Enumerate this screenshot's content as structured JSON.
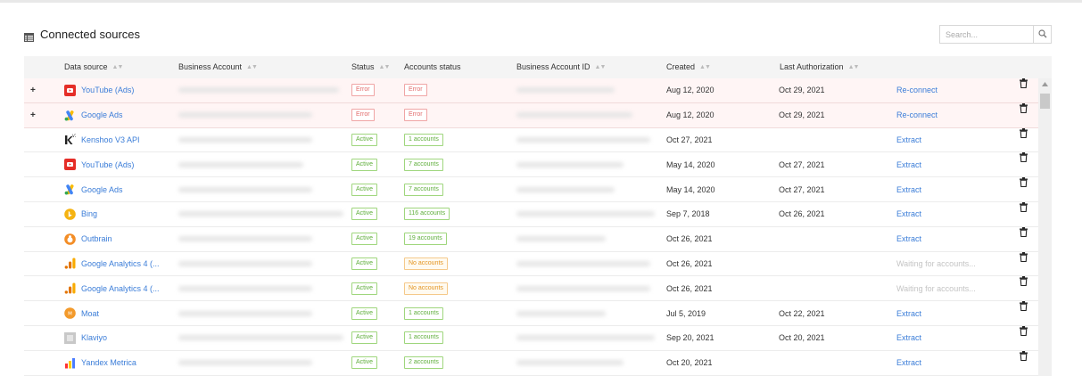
{
  "header": {
    "title": "Connected sources",
    "title_icon": "table-list-icon",
    "search_placeholder": "Search...",
    "search_icon": "search-icon"
  },
  "columns": {
    "data_source": "Data source",
    "business_account": "Business Account",
    "status": "Status",
    "accounts_status": "Accounts status",
    "business_account_id": "Business Account ID",
    "created": "Created",
    "last_authorization": "Last Authorization"
  },
  "rows": [
    {
      "expandable": true,
      "icon": "youtube-icon",
      "source": "YouTube (Ads)",
      "status": "Error",
      "status_type": "error",
      "accounts": "Error",
      "accounts_type": "error",
      "created": "Aug 12, 2020",
      "last_auth": "Oct 29, 2021",
      "action": "Re-connect",
      "action_type": "link"
    },
    {
      "expandable": true,
      "icon": "google-ads-icon",
      "source": "Google Ads",
      "status": "Error",
      "status_type": "error",
      "accounts": "Error",
      "accounts_type": "error",
      "created": "Aug 12, 2020",
      "last_auth": "Oct 29, 2021",
      "action": "Re-connect",
      "action_type": "link"
    },
    {
      "expandable": false,
      "icon": "kenshoo-icon",
      "source": "Kenshoo V3 API",
      "status": "Active",
      "status_type": "active",
      "accounts": "1 accounts",
      "accounts_type": "active",
      "created": "Oct 27, 2021",
      "last_auth": "",
      "action": "Extract",
      "action_type": "link"
    },
    {
      "expandable": false,
      "icon": "youtube-icon",
      "source": "YouTube (Ads)",
      "status": "Active",
      "status_type": "active",
      "accounts": "7 accounts",
      "accounts_type": "active",
      "created": "May 14, 2020",
      "last_auth": "Oct 27, 2021",
      "action": "Extract",
      "action_type": "link"
    },
    {
      "expandable": false,
      "icon": "google-ads-icon",
      "source": "Google Ads",
      "status": "Active",
      "status_type": "active",
      "accounts": "7 accounts",
      "accounts_type": "active",
      "created": "May 14, 2020",
      "last_auth": "Oct 27, 2021",
      "action": "Extract",
      "action_type": "link"
    },
    {
      "expandable": false,
      "icon": "bing-icon",
      "source": "Bing",
      "status": "Active",
      "status_type": "active",
      "accounts": "116 accounts",
      "accounts_type": "active",
      "created": "Sep 7, 2018",
      "last_auth": "Oct 26, 2021",
      "action": "Extract",
      "action_type": "link"
    },
    {
      "expandable": false,
      "icon": "outbrain-icon",
      "source": "Outbrain",
      "status": "Active",
      "status_type": "active",
      "accounts": "19 accounts",
      "accounts_type": "active",
      "created": "Oct 26, 2021",
      "last_auth": "",
      "action": "Extract",
      "action_type": "link"
    },
    {
      "expandable": false,
      "icon": "google-analytics-icon",
      "source": "Google Analytics 4 (...",
      "status": "Active",
      "status_type": "active",
      "accounts": "No accounts",
      "accounts_type": "none",
      "created": "Oct 26, 2021",
      "last_auth": "",
      "action": "Waiting for accounts...",
      "action_type": "wait"
    },
    {
      "expandable": false,
      "icon": "google-analytics-icon",
      "source": "Google Analytics 4 (...",
      "status": "Active",
      "status_type": "active",
      "accounts": "No accounts",
      "accounts_type": "none",
      "created": "Oct 26, 2021",
      "last_auth": "",
      "action": "Waiting for accounts...",
      "action_type": "wait"
    },
    {
      "expandable": false,
      "icon": "moat-icon",
      "source": "Moat",
      "status": "Active",
      "status_type": "active",
      "accounts": "1 accounts",
      "accounts_type": "active",
      "created": "Jul 5, 2019",
      "last_auth": "Oct 22, 2021",
      "action": "Extract",
      "action_type": "link"
    },
    {
      "expandable": false,
      "icon": "klaviyo-icon",
      "source": "Klaviyo",
      "status": "Active",
      "status_type": "active",
      "accounts": "1 accounts",
      "accounts_type": "active",
      "created": "Sep 20, 2021",
      "last_auth": "Oct 20, 2021",
      "action": "Extract",
      "action_type": "link"
    },
    {
      "expandable": false,
      "icon": "yandex-metrica-icon",
      "source": "Yandex Metrica",
      "status": "Active",
      "status_type": "active",
      "accounts": "2 accounts",
      "accounts_type": "active",
      "created": "Oct 20, 2021",
      "last_auth": "",
      "action": "Extract",
      "action_type": "link"
    }
  ],
  "colors": {
    "link": "#3b7dd8",
    "error": "#e26b6b",
    "active": "#5fae3b",
    "warning": "#e3931e",
    "error_row_bg": "#fff5f5"
  }
}
